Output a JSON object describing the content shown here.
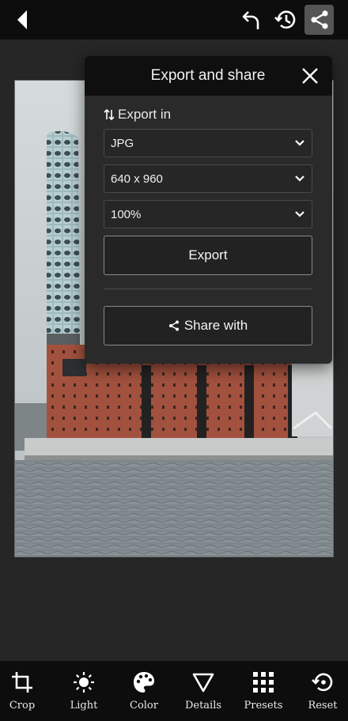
{
  "topbar": {
    "icons": [
      "back-arrow-icon",
      "undo-icon",
      "history-icon",
      "share-icon"
    ]
  },
  "export_panel": {
    "title": "Export and share",
    "export_in_label": "Export in",
    "format_value": "JPG",
    "size_value": "640 x 960",
    "quality_value": "100%",
    "export_button_label": "Export",
    "share_button_label": "Share with"
  },
  "toolbar": {
    "items": [
      {
        "label": "Crop",
        "icon": "crop-icon"
      },
      {
        "label": "Light",
        "icon": "sun-icon"
      },
      {
        "label": "Color",
        "icon": "palette-icon"
      },
      {
        "label": "Details",
        "icon": "triangle-icon"
      },
      {
        "label": "Presets",
        "icon": "grid-icon"
      },
      {
        "label": "Reset",
        "icon": "reset-icon"
      }
    ]
  },
  "colors": {
    "bar_background": "#0d0d0d",
    "canvas_background": "#262626",
    "panel_background": "#2a2a2a",
    "share_button_active": "#555555"
  }
}
